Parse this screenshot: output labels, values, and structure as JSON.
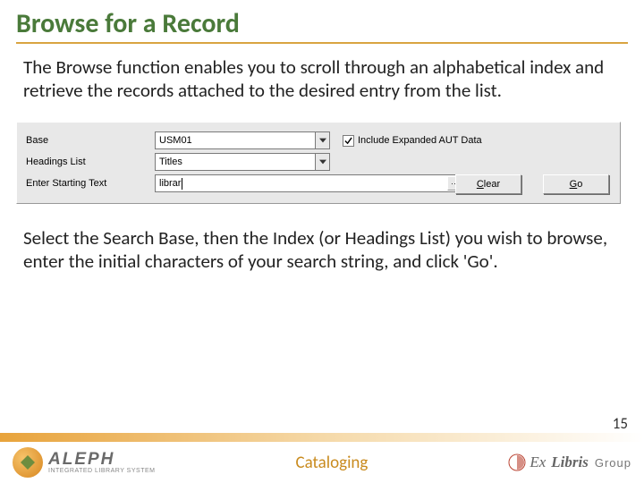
{
  "title": "Browse for a Record",
  "para1_a": "The ",
  "para1_b": "Browse",
  "para1_c": " function enables you to scroll through an alphabetical index and retrieve the records attached to the desired entry from the list.",
  "para2": "Select the Search Base, then the Index (or Headings List) you wish to browse, enter the initial characters of your search string, and click 'Go'.",
  "form": {
    "base_label": "Base",
    "base_value": "USM01",
    "headings_label": "Headings List",
    "headings_value": "Titles",
    "start_label": "Enter Starting Text",
    "start_value": "librar",
    "aut_label": "Include Expanded AUT Data",
    "clear_pre": "C",
    "clear_rest": "lear",
    "go_pre": "G",
    "go_rest": "o"
  },
  "footer": {
    "aleph": "ALEPH",
    "aleph_sub": "INTEGRATED LIBRARY SYSTEM",
    "center": "Cataloging",
    "ex": "Ex",
    "libris": "Libris",
    "group": "Group"
  },
  "page": "15"
}
